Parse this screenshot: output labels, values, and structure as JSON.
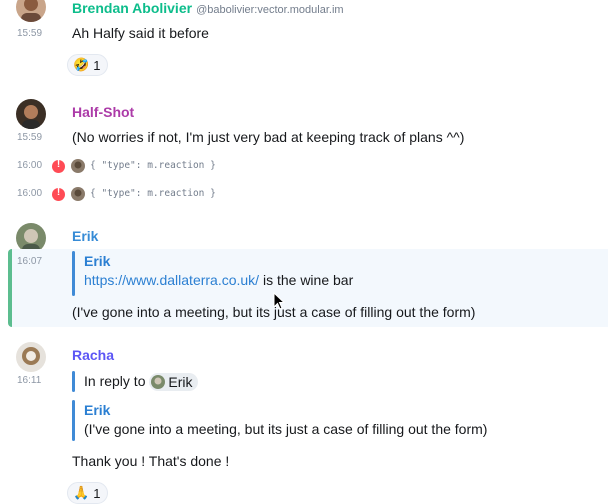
{
  "messages": {
    "m1": {
      "sender": "Brendan Abolivier",
      "mxid": "@babolivier:vector.modular.im",
      "time": "15:59",
      "text": "Ah Halfy said it before",
      "reaction": {
        "emoji": "🤣",
        "count": "1"
      }
    },
    "m2": {
      "sender": "Half-Shot",
      "time": "15:59",
      "text": "(No worries if not, I'm just very bad at keeping track of plans ^^)"
    },
    "hidden": [
      {
        "time": "16:00",
        "text": "{ \"type\": m.reaction }"
      },
      {
        "time": "16:00",
        "text": "{ \"type\": m.reaction }"
      }
    ],
    "m3": {
      "sender": "Erik",
      "time": "16:07",
      "quote": {
        "sender": "Erik",
        "link": "https://www.dallaterra.co.uk/",
        "after": " is the wine bar"
      },
      "text": "(I've gone into a meeting, but its just a case of filling out the form)"
    },
    "m4": {
      "sender": "Racha",
      "time": "16:11",
      "in_reply_to": "In reply to",
      "reply_user": "Erik",
      "quote": {
        "sender": "Erik",
        "text": "(I've gone into a meeting, but its just a case of filling out the form)"
      },
      "text": "Thank you ! That's done !",
      "reaction": {
        "emoji": "🙏",
        "count": "1"
      }
    }
  },
  "colors": {
    "brendan": "#0dbd8b",
    "erik": "#368bd6",
    "racha": "#5c56f5",
    "highlight_border": "#5cbd8f",
    "warning": "#ff4b55"
  }
}
